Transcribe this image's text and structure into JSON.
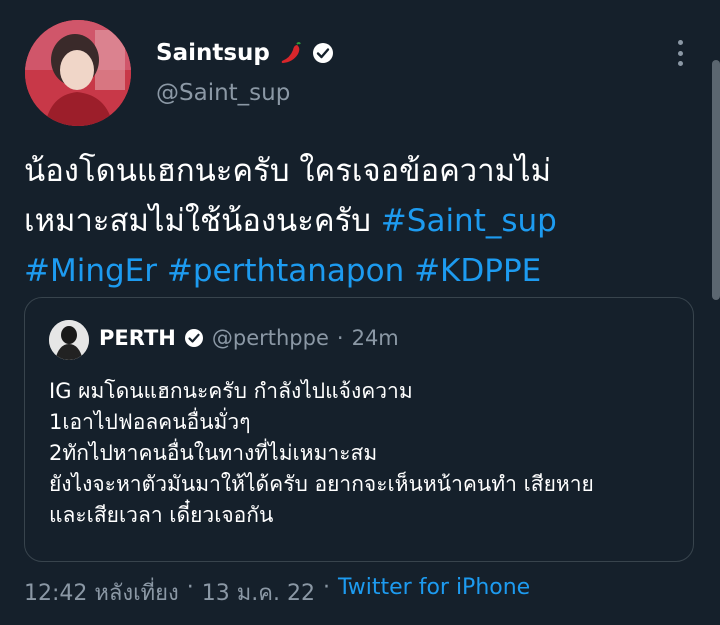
{
  "author": {
    "name": "Saintsup",
    "handle": "@Saint_sup",
    "emoji_icon": "chili-pepper-icon",
    "verified": true
  },
  "tweet": {
    "lines": [
      [
        {
          "text": "น้องโดนแฮกนะครับ ใครเจอข้อความไม่",
          "hashtag": false
        }
      ],
      [
        {
          "text": "เหมาะสมไม่ใช้น้องนะครับ ",
          "hashtag": false
        },
        {
          "text": "#Saint_sup",
          "hashtag": true
        }
      ],
      [
        {
          "text": "#MingEr",
          "hashtag": true
        },
        {
          "text": " ",
          "hashtag": false
        },
        {
          "text": "#perthtanapon",
          "hashtag": true
        },
        {
          "text": " ",
          "hashtag": false
        },
        {
          "text": "#KDPPE",
          "hashtag": true
        }
      ]
    ]
  },
  "quote": {
    "name": "PERTH",
    "handle": "@perthppe",
    "separator": "·",
    "time": "24m",
    "verified": true,
    "lines": [
      "IG ผมโดนแฮกนะครับ กำลังไปแจ้งความ",
      "1เอาไปฟอลคนอื่นมั่วๆ",
      "2ทักไปหาคนอื่นในทางที่ไม่เหมาะสม",
      "ยังไงจะหาตัวมันมาให้ได้ครับ อยากจะเห็นหน้าคนทำ เสียหาย",
      "และเสียเวลา เดี๋ยวเจอกัน"
    ]
  },
  "meta": {
    "time": "12:42 หลังเที่ยง",
    "separator": "·",
    "date": "13 ม.ค. 22",
    "source": "Twitter for iPhone"
  },
  "colors": {
    "background": "#15202b",
    "accent": "#1d9bf0",
    "secondary_text": "#8b98a5",
    "border": "#38444d"
  }
}
